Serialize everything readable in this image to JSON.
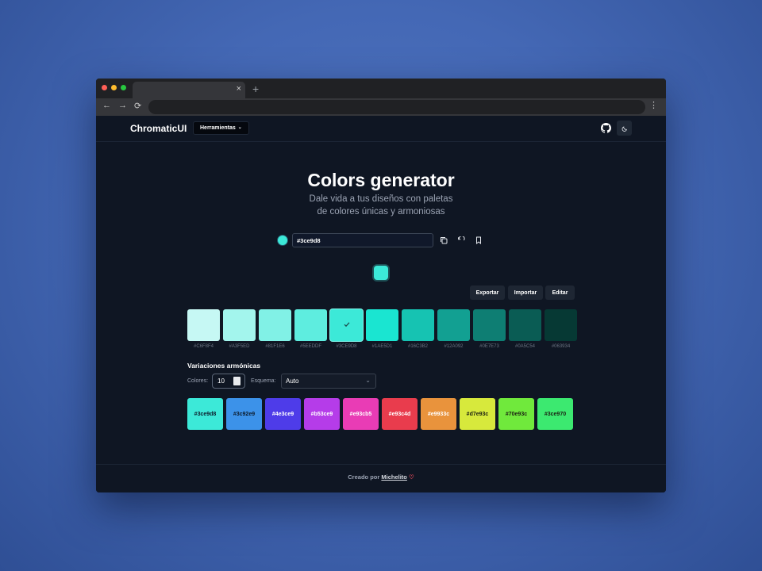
{
  "browser": {
    "dots": [
      "#ff5f57",
      "#febc2e",
      "#28c840"
    ],
    "tab_close": "×",
    "new_tab": "+"
  },
  "header": {
    "brand": "ChromaticUI",
    "tools_label": "Herramientas",
    "tools_chevron": "⌄"
  },
  "hero": {
    "title": "Colors generator",
    "subtitle_line1": "Dale vida a tus diseños con paletas",
    "subtitle_line2": "de colores únicas y armoniosas"
  },
  "picker": {
    "current_color": "#3ce9d8",
    "hex_value": "#3ce9d8"
  },
  "actions": {
    "export": "Exportar",
    "import": "Importar",
    "edit": "Editar"
  },
  "shades": [
    {
      "label": "#C6F8F4",
      "color": "#c6f8f4",
      "selected": false
    },
    {
      "label": "#A3F5ED",
      "color": "#a3f5ed",
      "selected": false
    },
    {
      "label": "#81F1E6",
      "color": "#81f1e6",
      "selected": false
    },
    {
      "label": "#5EEDDF",
      "color": "#5eeddf",
      "selected": false
    },
    {
      "label": "#3CE9D8",
      "color": "#3ce9d8",
      "selected": true
    },
    {
      "label": "#1AE5D1",
      "color": "#1ae5d1",
      "selected": false
    },
    {
      "label": "#16C3B2",
      "color": "#16c3b2",
      "selected": false
    },
    {
      "label": "#12A092",
      "color": "#12a092",
      "selected": false
    },
    {
      "label": "#0E7E73",
      "color": "#0e7e73",
      "selected": false
    },
    {
      "label": "#0A5C54",
      "color": "#0a5c54",
      "selected": false
    },
    {
      "label": "#063934",
      "color": "#063934",
      "selected": false
    }
  ],
  "harmonics": {
    "title": "Variaciones armónicas",
    "colors_label": "Colores:",
    "colors_value": "10",
    "scheme_label": "Esquema:",
    "scheme_value": "Auto",
    "scheme_chevron": "⌄",
    "swatches": [
      {
        "label": "#3ce9d8",
        "color": "#3ce9d8",
        "text": "#0d1b2a"
      },
      {
        "label": "#3c92e9",
        "color": "#3c92e9",
        "text": "#0d1b2a"
      },
      {
        "label": "#4e3ce9",
        "color": "#4e3ce9",
        "text": "#ffffff"
      },
      {
        "label": "#b53ce9",
        "color": "#b53ce9",
        "text": "#ffffff"
      },
      {
        "label": "#e93cb5",
        "color": "#e93cb5",
        "text": "#ffffff"
      },
      {
        "label": "#e93c4d",
        "color": "#e93c4d",
        "text": "#ffffff"
      },
      {
        "label": "#e9933c",
        "color": "#e9933c",
        "text": "#ffffff"
      },
      {
        "label": "#d7e93c",
        "color": "#d7e93c",
        "text": "#1b1f12"
      },
      {
        "label": "#70e93c",
        "color": "#70e93c",
        "text": "#1b1f12"
      },
      {
        "label": "#3ce970",
        "color": "#3ce970",
        "text": "#1b1f12"
      }
    ]
  },
  "footer": {
    "prefix": "Creado por",
    "author": "Michelito",
    "heart": "♡"
  }
}
